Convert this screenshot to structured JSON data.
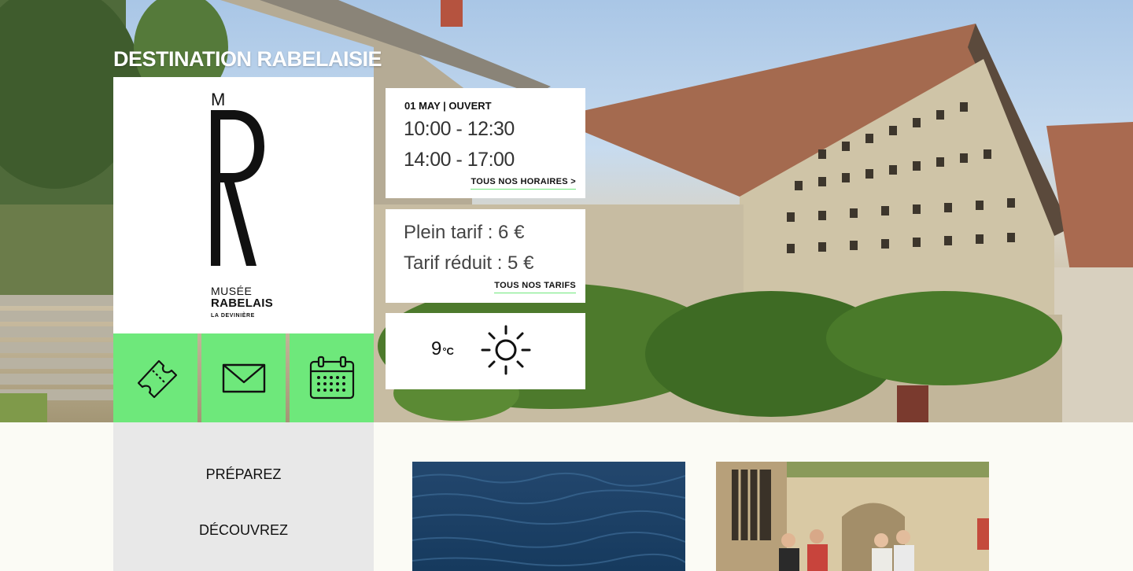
{
  "brand": {
    "title": "DESTINATION RABELAISIE"
  },
  "logo": {
    "monogram_small": "M",
    "line1": "MUSÉE",
    "line2": "RABELAIS",
    "line3": "LA DEVINIÈRE"
  },
  "quick_actions": [
    {
      "icon": "ticket-icon"
    },
    {
      "icon": "envelope-icon"
    },
    {
      "icon": "calendar-icon"
    }
  ],
  "hours": {
    "date_label": "01 MAY | OUVERT",
    "slot1": "10:00 - 12:30",
    "slot2": "14:00 - 17:00",
    "link": "TOUS NOS HORAIRES >"
  },
  "tarifs": {
    "plein": "Plein tarif : 6 €",
    "reduit": "Tarif réduit : 5 €",
    "link": "TOUS NOS TARIFS"
  },
  "weather": {
    "value": "9",
    "unit": "°C",
    "icon": "sun-icon"
  },
  "nav": [
    {
      "label": "PRÉPAREZ"
    },
    {
      "label": "DÉCOUVREZ"
    }
  ],
  "colors": {
    "accent": "#6ee87b",
    "sidebar": "#e8e8e8",
    "background": "#fbfbf5"
  }
}
